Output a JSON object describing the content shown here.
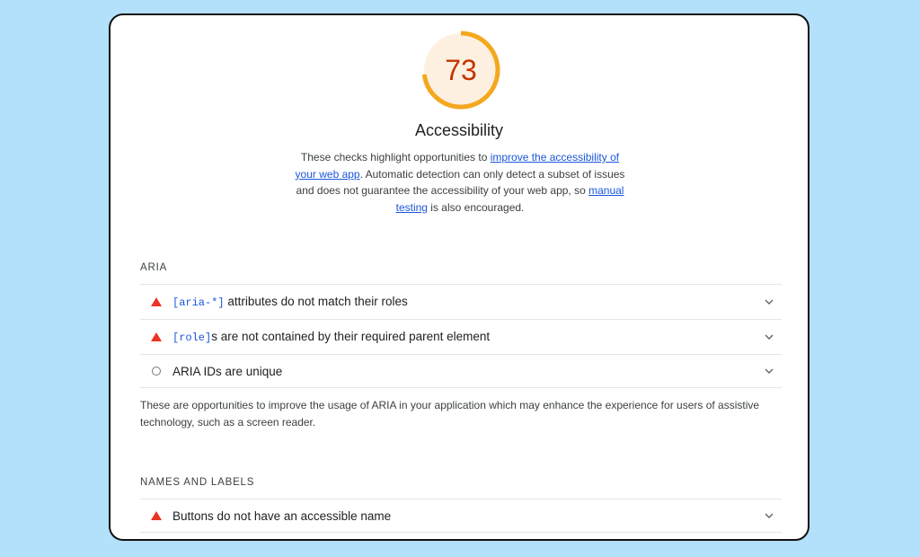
{
  "category": {
    "score": "73",
    "score_fraction": 0.73,
    "ring_color": "#f4a81f",
    "ring_bg_color": "#fef0e0",
    "score_text_color": "#c33300",
    "title": "Accessibility",
    "description": {
      "part1": "These checks highlight opportunities to ",
      "link1": "improve the accessibility of your web app",
      "part2": ". Automatic detection can only detect a subset of issues and does not guarantee the accessibility of your web app, so ",
      "link2": "manual testing",
      "part3": " is also encouraged."
    }
  },
  "groups": {
    "aria": {
      "title": "ARIA",
      "audits": [
        {
          "status": "fail",
          "code": "[aria-*]",
          "text": " attributes do not match their roles"
        },
        {
          "status": "fail",
          "code": "[role]",
          "text": "s are not contained by their required parent element"
        },
        {
          "status": "informative",
          "code": "",
          "text": "ARIA IDs are unique"
        }
      ],
      "description": "These are opportunities to improve the usage of ARIA in your application which may enhance the experience for users of assistive technology, such as a screen reader."
    },
    "names": {
      "title": "NAMES AND LABELS",
      "audits": [
        {
          "status": "fail",
          "code": "",
          "text": "Buttons do not have an accessible name"
        }
      ]
    }
  },
  "icons": {
    "fail": "warning-triangle-icon",
    "informative": "circle-icon",
    "expand": "chevron-down-icon"
  }
}
